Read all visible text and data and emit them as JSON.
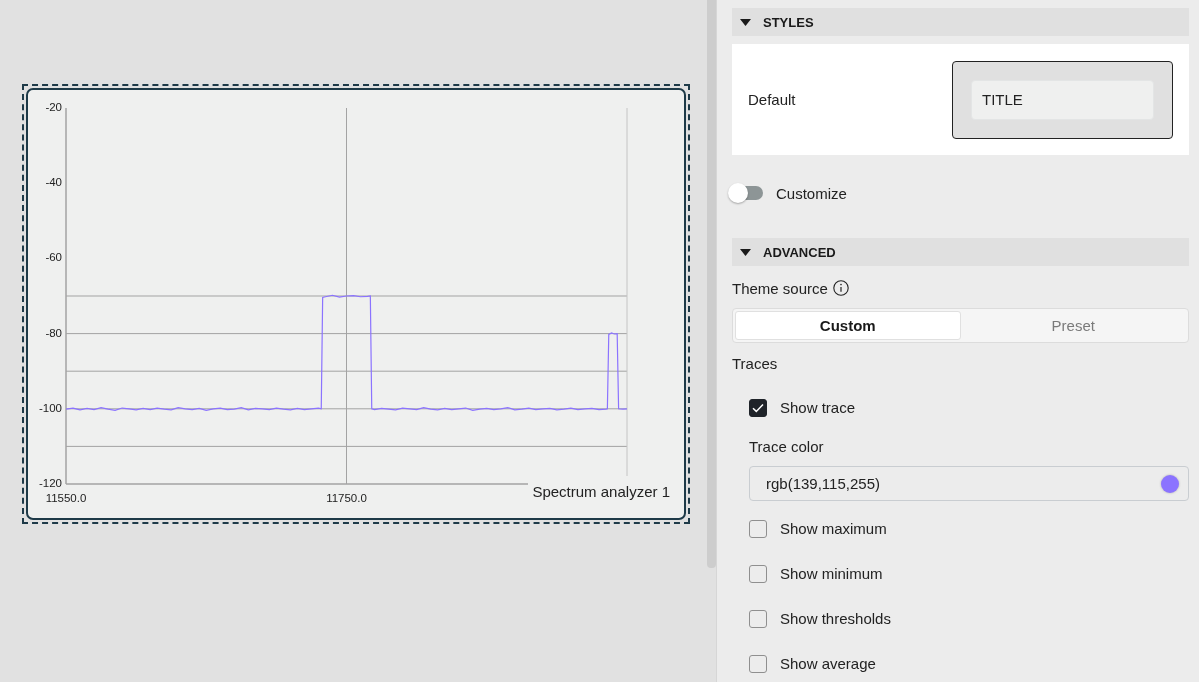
{
  "chart_widget": {
    "selected": true,
    "chart_data": {
      "type": "line",
      "title": "Spectrum analyzer 1",
      "x": [
        11550,
        11555,
        11560,
        11565,
        11570,
        11575,
        11580,
        11585,
        11590,
        11595,
        11600,
        11605,
        11610,
        11615,
        11620,
        11625,
        11630,
        11635,
        11640,
        11645,
        11650,
        11655,
        11660,
        11665,
        11670,
        11675,
        11680,
        11685,
        11690,
        11695,
        11700,
        11705,
        11710,
        11715,
        11720,
        11725,
        11730,
        11732,
        11733,
        11735,
        11740,
        11745,
        11750,
        11755,
        11760,
        11765,
        11767,
        11768,
        11770,
        11775,
        11780,
        11785,
        11790,
        11795,
        11800,
        11805,
        11810,
        11815,
        11820,
        11825,
        11830,
        11835,
        11840,
        11845,
        11850,
        11855,
        11860,
        11865,
        11870,
        11875,
        11880,
        11885,
        11890,
        11895,
        11900,
        11905,
        11910,
        11915,
        11920,
        11925,
        11930,
        11935,
        11936,
        11937,
        11939,
        11941,
        11943,
        11944,
        11947,
        11950
      ],
      "series": [
        {
          "color": "#8b73ff",
          "values": [
            -100.1,
            -99.8,
            -100.3,
            -99.9,
            -100.2,
            -99.7,
            -100.1,
            -100.4,
            -99.8,
            -100,
            -100.3,
            -99.9,
            -100.2,
            -99.8,
            -100.1,
            -100.3,
            -99.7,
            -100,
            -100.2,
            -99.9,
            -100.4,
            -100,
            -99.8,
            -100.2,
            -100.1,
            -99.7,
            -100.3,
            -99.9,
            -100,
            -100.2,
            -99.8,
            -100.1,
            -100.3,
            -99.9,
            -100.2,
            -100,
            -99.8,
            -100,
            -70.4,
            -70.2,
            -69.8,
            -70.3,
            -70,
            -69.9,
            -70.2,
            -70.1,
            -70,
            -100,
            -100.2,
            -99.9,
            -100.1,
            -100.3,
            -99.8,
            -100,
            -100.2,
            -99.7,
            -100.1,
            -100.3,
            -99.9,
            -100.2,
            -100,
            -99.8,
            -100.4,
            -100.1,
            -99.9,
            -100.2,
            -100,
            -99.7,
            -100.3,
            -100.1,
            -99.8,
            -100.2,
            -100,
            -99.9,
            -100.3,
            -100.1,
            -99.8,
            -100.2,
            -100,
            -99.9,
            -100.2,
            -100.1,
            -100,
            -80.2,
            -79.8,
            -80.1,
            -80,
            -100,
            -100.1,
            -100
          ]
        }
      ],
      "xlim": [
        11550,
        11950
      ],
      "ylim": [
        -120,
        -20
      ],
      "xticks": [
        {
          "value": 11550,
          "label": "11550.0"
        },
        {
          "value": 11750,
          "label": "11750.0"
        }
      ],
      "yticks": [
        -120,
        -100,
        -80,
        -60,
        -40,
        -20
      ],
      "grid": true,
      "ref_lines": [
        {
          "axis": "y",
          "value": -70
        },
        {
          "axis": "y",
          "value": -80
        },
        {
          "axis": "y",
          "value": -90
        },
        {
          "axis": "y",
          "value": -100
        },
        {
          "axis": "y",
          "value": -110
        }
      ]
    }
  },
  "styles_section": {
    "title": "STYLES",
    "expanded": true,
    "styles": [
      {
        "label": "Default",
        "preview_text": "TITLE",
        "selected": true
      }
    ],
    "customize": {
      "label": "Customize",
      "on": false
    }
  },
  "advanced_section": {
    "title": "ADVANCED",
    "expanded": true,
    "theme_source": {
      "label": "Theme source",
      "options": [
        {
          "label": "Custom",
          "selected": true
        },
        {
          "label": "Preset",
          "selected": false
        }
      ]
    },
    "traces": {
      "label": "Traces",
      "items": [
        {
          "kind": "checkbox",
          "label": "Show trace",
          "checked": true
        },
        {
          "kind": "color",
          "label": "Trace color",
          "value": "rgb(139,115,255)",
          "color": "#8b73ff"
        },
        {
          "kind": "checkbox",
          "label": "Show maximum",
          "checked": false
        },
        {
          "kind": "checkbox",
          "label": "Show minimum",
          "checked": false
        },
        {
          "kind": "checkbox",
          "label": "Show thresholds",
          "checked": false
        },
        {
          "kind": "checkbox",
          "label": "Show average",
          "checked": false
        }
      ]
    }
  }
}
